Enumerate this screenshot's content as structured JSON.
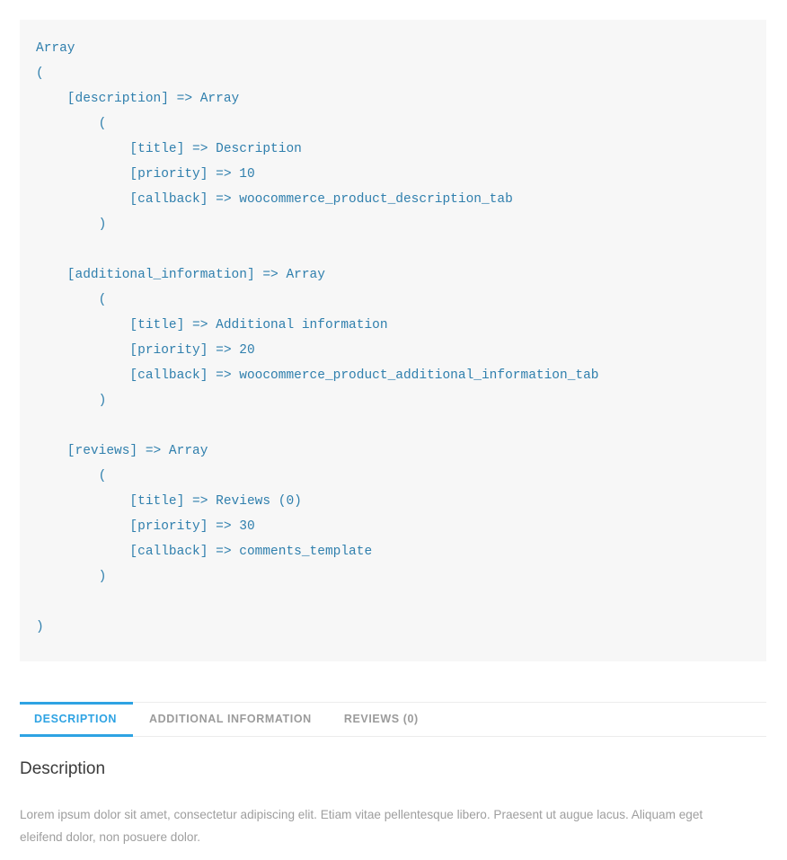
{
  "colors": {
    "code_text": "#2f7fad",
    "code_background": "#f7f7f7",
    "tab_active": "#2ea3e3",
    "tab_inactive": "#9b9b9b",
    "heading": "#3a3a3a",
    "body_text": "#9e9e9e",
    "divider": "#ececec",
    "page_background": "#ffffff"
  },
  "code_dump": {
    "language": "php-print-r",
    "text": "Array\n(\n    [description] => Array\n        (\n            [title] => Description\n            [priority] => 10\n            [callback] => woocommerce_product_description_tab\n        )\n\n    [additional_information] => Array\n        (\n            [title] => Additional information\n            [priority] => 20\n            [callback] => woocommerce_product_additional_information_tab\n        )\n\n    [reviews] => Array\n        (\n            [title] => Reviews (0)\n            [priority] => 30\n            [callback] => comments_template\n        )\n\n)",
    "lines": [
      "Array",
      "(",
      "    [description] => Array",
      "        (",
      "            [title] => Description",
      "            [priority] => 10",
      "            [callback] => woocommerce_product_description_tab",
      "        )",
      "",
      "    [additional_information] => Array",
      "        (",
      "            [title] => Additional information",
      "            [priority] => 20",
      "            [callback] => woocommerce_product_additional_information_tab",
      "        )",
      "",
      "    [reviews] => Array",
      "        (",
      "            [title] => Reviews (0)",
      "            [priority] => 30",
      "            [callback] => comments_template",
      "        )",
      "",
      ")"
    ],
    "entries": [
      {
        "key": "description",
        "title": "Description",
        "priority": "10",
        "callback": "woocommerce_product_description_tab"
      },
      {
        "key": "additional_information",
        "title": "Additional information",
        "priority": "20",
        "callback": "woocommerce_product_additional_information_tab"
      },
      {
        "key": "reviews",
        "title": "Reviews (0)",
        "priority": "30",
        "callback": "comments_template"
      }
    ]
  },
  "tabs": {
    "items": [
      {
        "id": "description",
        "label": "DESCRIPTION",
        "active": true
      },
      {
        "id": "additional-information",
        "label": "ADDITIONAL INFORMATION",
        "active": false
      },
      {
        "id": "reviews",
        "label": "REVIEWS (0)",
        "active": false
      }
    ]
  },
  "panel": {
    "heading": "Description",
    "paragraph": "Lorem ipsum dolor sit amet, consectetur adipiscing elit. Etiam vitae pellentesque libero. Praesent ut augue lacus. Aliquam eget eleifend dolor, non posuere dolor."
  }
}
